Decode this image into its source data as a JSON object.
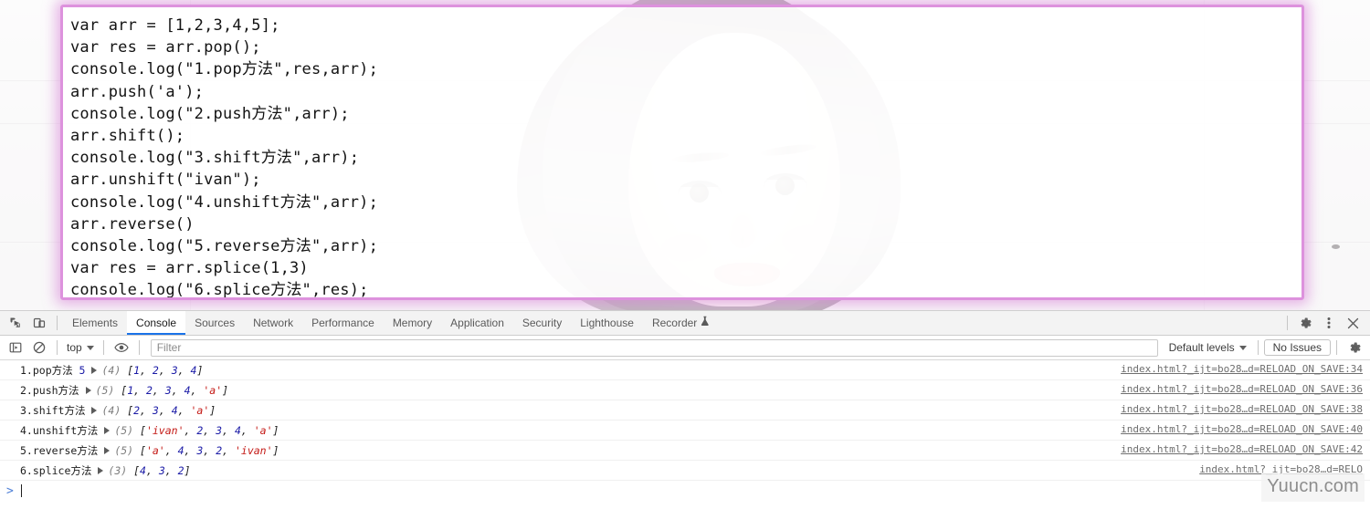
{
  "code_block": {
    "lines": [
      "var arr = [1,2,3,4,5];",
      "var res = arr.pop();",
      "console.log(\"1.pop方法\",res,arr);",
      "arr.push('a');",
      "console.log(\"2.push方法\",arr);",
      "arr.shift();",
      "console.log(\"3.shift方法\",arr);",
      "arr.unshift(\"ivan\");",
      "console.log(\"4.unshift方法\",arr);",
      "arr.reverse()",
      "console.log(\"5.reverse方法\",arr);",
      "var res = arr.splice(1,3)",
      "console.log(\"6.splice方法\",res);"
    ],
    "border_color": "#dd92dd"
  },
  "devtools": {
    "left_icons": [
      {
        "name": "inspect-element-icon",
        "title": "Inspect element"
      },
      {
        "name": "device-toolbar-icon",
        "title": "Toggle device toolbar"
      }
    ],
    "tabs": [
      {
        "label": "Elements",
        "active": false
      },
      {
        "label": "Console",
        "active": true
      },
      {
        "label": "Sources",
        "active": false
      },
      {
        "label": "Network",
        "active": false
      },
      {
        "label": "Performance",
        "active": false
      },
      {
        "label": "Memory",
        "active": false
      },
      {
        "label": "Application",
        "active": false
      },
      {
        "label": "Security",
        "active": false
      },
      {
        "label": "Lighthouse",
        "active": false
      },
      {
        "label": "Recorder",
        "active": false,
        "badge_icon": "flask-icon"
      }
    ],
    "active_tab_underline_color": "#1a73e8",
    "right_icons": [
      {
        "name": "settings-gear-icon",
        "title": "Settings"
      },
      {
        "name": "more-options-icon",
        "title": "Customize and control DevTools"
      },
      {
        "name": "close-devtools-icon",
        "title": "Close DevTools"
      }
    ],
    "filter_bar": {
      "sidebar_toggle_icon": "console-sidebar-icon",
      "clear_console_icon": "clear-console-icon",
      "context_label": "top",
      "live_expression_icon": "eye-icon",
      "filter_placeholder": "Filter",
      "filter_value": "",
      "levels_label": "Default levels",
      "issues_label": "No Issues",
      "settings_icon": "console-settings-gear-icon"
    },
    "messages": [
      {
        "label": "1.pop方法",
        "extra_value": "5",
        "count": "(4)",
        "tokens": [
          {
            "t": "[",
            "k": "p"
          },
          {
            "t": "1",
            "k": "n"
          },
          {
            "t": ", ",
            "k": "p"
          },
          {
            "t": "2",
            "k": "n"
          },
          {
            "t": ", ",
            "k": "p"
          },
          {
            "t": "3",
            "k": "n"
          },
          {
            "t": ", ",
            "k": "p"
          },
          {
            "t": "4",
            "k": "n"
          },
          {
            "t": "]",
            "k": "p"
          }
        ],
        "source": "index.html?_ijt=bo28…d=RELOAD_ON_SAVE:34"
      },
      {
        "label": "2.push方法",
        "extra_value": "",
        "count": "(5)",
        "tokens": [
          {
            "t": "[",
            "k": "p"
          },
          {
            "t": "1",
            "k": "n"
          },
          {
            "t": ", ",
            "k": "p"
          },
          {
            "t": "2",
            "k": "n"
          },
          {
            "t": ", ",
            "k": "p"
          },
          {
            "t": "3",
            "k": "n"
          },
          {
            "t": ", ",
            "k": "p"
          },
          {
            "t": "4",
            "k": "n"
          },
          {
            "t": ", ",
            "k": "p"
          },
          {
            "t": "'a'",
            "k": "s"
          },
          {
            "t": "]",
            "k": "p"
          }
        ],
        "source": "index.html?_ijt=bo28…d=RELOAD_ON_SAVE:36"
      },
      {
        "label": "3.shift方法",
        "extra_value": "",
        "count": "(4)",
        "tokens": [
          {
            "t": "[",
            "k": "p"
          },
          {
            "t": "2",
            "k": "n"
          },
          {
            "t": ", ",
            "k": "p"
          },
          {
            "t": "3",
            "k": "n"
          },
          {
            "t": ", ",
            "k": "p"
          },
          {
            "t": "4",
            "k": "n"
          },
          {
            "t": ", ",
            "k": "p"
          },
          {
            "t": "'a'",
            "k": "s"
          },
          {
            "t": "]",
            "k": "p"
          }
        ],
        "source": "index.html?_ijt=bo28…d=RELOAD_ON_SAVE:38"
      },
      {
        "label": "4.unshift方法",
        "extra_value": "",
        "count": "(5)",
        "tokens": [
          {
            "t": "[",
            "k": "p"
          },
          {
            "t": "'ivan'",
            "k": "s"
          },
          {
            "t": ", ",
            "k": "p"
          },
          {
            "t": "2",
            "k": "n"
          },
          {
            "t": ", ",
            "k": "p"
          },
          {
            "t": "3",
            "k": "n"
          },
          {
            "t": ", ",
            "k": "p"
          },
          {
            "t": "4",
            "k": "n"
          },
          {
            "t": ", ",
            "k": "p"
          },
          {
            "t": "'a'",
            "k": "s"
          },
          {
            "t": "]",
            "k": "p"
          }
        ],
        "source": "index.html?_ijt=bo28…d=RELOAD_ON_SAVE:40"
      },
      {
        "label": "5.reverse方法",
        "extra_value": "",
        "count": "(5)",
        "tokens": [
          {
            "t": "[",
            "k": "p"
          },
          {
            "t": "'a'",
            "k": "s"
          },
          {
            "t": ", ",
            "k": "p"
          },
          {
            "t": "4",
            "k": "n"
          },
          {
            "t": ", ",
            "k": "p"
          },
          {
            "t": "3",
            "k": "n"
          },
          {
            "t": ", ",
            "k": "p"
          },
          {
            "t": "2",
            "k": "n"
          },
          {
            "t": ", ",
            "k": "p"
          },
          {
            "t": "'ivan'",
            "k": "s"
          },
          {
            "t": "]",
            "k": "p"
          }
        ],
        "source": "index.html?_ijt=bo28…d=RELOAD_ON_SAVE:42"
      },
      {
        "label": "6.splice方法",
        "extra_value": "",
        "count": "(3)",
        "tokens": [
          {
            "t": "[",
            "k": "p"
          },
          {
            "t": "4",
            "k": "n"
          },
          {
            "t": ", ",
            "k": "p"
          },
          {
            "t": "3",
            "k": "n"
          },
          {
            "t": ", ",
            "k": "p"
          },
          {
            "t": "2",
            "k": "n"
          },
          {
            "t": "]",
            "k": "p"
          }
        ],
        "source": "index.html?_ijt=bo28…d=RELO"
      }
    ],
    "prompt": {
      "chevron": ">",
      "value": ""
    }
  },
  "watermark": {
    "text": "Yuucn.com"
  },
  "colors": {
    "accent_blue": "#1a73e8",
    "console_number": "#1a1aa6",
    "console_string": "#c41a16",
    "code_border_pink": "#dd92dd"
  }
}
